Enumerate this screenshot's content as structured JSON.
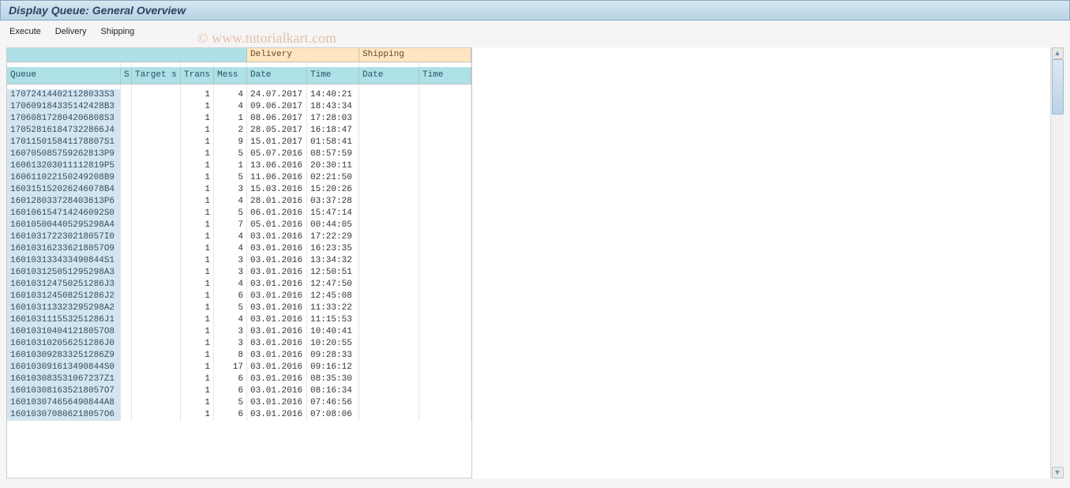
{
  "title": "Display Queue: General Overview",
  "menu": {
    "execute": "Execute",
    "delivery": "Delivery",
    "shipping": "Shipping"
  },
  "watermark": "© www.tutorialkart.com",
  "headers": {
    "group_delivery": "Delivery",
    "group_shipping": "Shipping",
    "queue": "Queue",
    "s": "S",
    "target": "Target s",
    "trans": "Trans",
    "mess": "Mess",
    "d_date": "Date",
    "d_time": "Time",
    "s_date": "Date",
    "s_time": "Time"
  },
  "rows": [
    {
      "queue": "170724144021128033S3",
      "s": "",
      "target": "",
      "trans": "1",
      "mess": "4",
      "d_date": "24.07.2017",
      "d_time": "14:40:21",
      "s_date": "",
      "s_time": ""
    },
    {
      "queue": "170609184335142428B3",
      "s": "",
      "target": "",
      "trans": "1",
      "mess": "4",
      "d_date": "09.06.2017",
      "d_time": "18:43:34",
      "s_date": "",
      "s_time": ""
    },
    {
      "queue": "170608172804206808S3",
      "s": "",
      "target": "",
      "trans": "1",
      "mess": "1",
      "d_date": "08.06.2017",
      "d_time": "17:28:03",
      "s_date": "",
      "s_time": ""
    },
    {
      "queue": "170528161847322866J4",
      "s": "",
      "target": "",
      "trans": "1",
      "mess": "2",
      "d_date": "28.05.2017",
      "d_time": "16:18:47",
      "s_date": "",
      "s_time": ""
    },
    {
      "queue": "170115015841178807S1",
      "s": "",
      "target": "",
      "trans": "1",
      "mess": "9",
      "d_date": "15.01.2017",
      "d_time": "01:58:41",
      "s_date": "",
      "s_time": ""
    },
    {
      "queue": "160705085759262813P9",
      "s": "",
      "target": "",
      "trans": "1",
      "mess": "5",
      "d_date": "05.07.2016",
      "d_time": "08:57:59",
      "s_date": "",
      "s_time": ""
    },
    {
      "queue": "160613203011112819P5",
      "s": "",
      "target": "",
      "trans": "1",
      "mess": "1",
      "d_date": "13.06.2016",
      "d_time": "20:30:11",
      "s_date": "",
      "s_time": ""
    },
    {
      "queue": "160611022150249208B9",
      "s": "",
      "target": "",
      "trans": "1",
      "mess": "5",
      "d_date": "11.06.2016",
      "d_time": "02:21:50",
      "s_date": "",
      "s_time": ""
    },
    {
      "queue": "160315152026246078B4",
      "s": "",
      "target": "",
      "trans": "1",
      "mess": "3",
      "d_date": "15.03.2016",
      "d_time": "15:20:26",
      "s_date": "",
      "s_time": ""
    },
    {
      "queue": "160128033728403613P6",
      "s": "",
      "target": "",
      "trans": "1",
      "mess": "4",
      "d_date": "28.01.2016",
      "d_time": "03:37:28",
      "s_date": "",
      "s_time": ""
    },
    {
      "queue": "160106154714246092S0",
      "s": "",
      "target": "",
      "trans": "1",
      "mess": "5",
      "d_date": "06.01.2016",
      "d_time": "15:47:14",
      "s_date": "",
      "s_time": ""
    },
    {
      "queue": "160105004405295298A4",
      "s": "",
      "target": "",
      "trans": "1",
      "mess": "7",
      "d_date": "05.01.2016",
      "d_time": "00:44:05",
      "s_date": "",
      "s_time": ""
    },
    {
      "queue": "160103172230218057I0",
      "s": "",
      "target": "",
      "trans": "1",
      "mess": "4",
      "d_date": "03.01.2016",
      "d_time": "17:22:29",
      "s_date": "",
      "s_time": ""
    },
    {
      "queue": "160103162336218057O9",
      "s": "",
      "target": "",
      "trans": "1",
      "mess": "4",
      "d_date": "03.01.2016",
      "d_time": "16:23:35",
      "s_date": "",
      "s_time": ""
    },
    {
      "queue": "160103133433490844S1",
      "s": "",
      "target": "",
      "trans": "1",
      "mess": "3",
      "d_date": "03.01.2016",
      "d_time": "13:34:32",
      "s_date": "",
      "s_time": ""
    },
    {
      "queue": "160103125051295298A3",
      "s": "",
      "target": "",
      "trans": "1",
      "mess": "3",
      "d_date": "03.01.2016",
      "d_time": "12:50:51",
      "s_date": "",
      "s_time": ""
    },
    {
      "queue": "160103124750251286J3",
      "s": "",
      "target": "",
      "trans": "1",
      "mess": "4",
      "d_date": "03.01.2016",
      "d_time": "12:47:50",
      "s_date": "",
      "s_time": ""
    },
    {
      "queue": "160103124508251286J2",
      "s": "",
      "target": "",
      "trans": "1",
      "mess": "6",
      "d_date": "03.01.2016",
      "d_time": "12:45:08",
      "s_date": "",
      "s_time": ""
    },
    {
      "queue": "160103113323295298A2",
      "s": "",
      "target": "",
      "trans": "1",
      "mess": "5",
      "d_date": "03.01.2016",
      "d_time": "11:33:22",
      "s_date": "",
      "s_time": ""
    },
    {
      "queue": "160103111553251286J1",
      "s": "",
      "target": "",
      "trans": "1",
      "mess": "4",
      "d_date": "03.01.2016",
      "d_time": "11:15:53",
      "s_date": "",
      "s_time": ""
    },
    {
      "queue": "160103104041218057O8",
      "s": "",
      "target": "",
      "trans": "1",
      "mess": "3",
      "d_date": "03.01.2016",
      "d_time": "10:40:41",
      "s_date": "",
      "s_time": ""
    },
    {
      "queue": "160103102056251286J0",
      "s": "",
      "target": "",
      "trans": "1",
      "mess": "3",
      "d_date": "03.01.2016",
      "d_time": "10:20:55",
      "s_date": "",
      "s_time": ""
    },
    {
      "queue": "160103092833251286Z9",
      "s": "",
      "target": "",
      "trans": "1",
      "mess": "8",
      "d_date": "03.01.2016",
      "d_time": "09:28:33",
      "s_date": "",
      "s_time": ""
    },
    {
      "queue": "160103091613490844S0",
      "s": "",
      "target": "",
      "trans": "1",
      "mess": "17",
      "d_date": "03.01.2016",
      "d_time": "09:16:12",
      "s_date": "",
      "s_time": ""
    },
    {
      "queue": "160103083531067237Z1",
      "s": "",
      "target": "",
      "trans": "1",
      "mess": "6",
      "d_date": "03.01.2016",
      "d_time": "08:35:30",
      "s_date": "",
      "s_time": ""
    },
    {
      "queue": "160103081635218057O7",
      "s": "",
      "target": "",
      "trans": "1",
      "mess": "6",
      "d_date": "03.01.2016",
      "d_time": "08:16:34",
      "s_date": "",
      "s_time": ""
    },
    {
      "queue": "160103074656490844A8",
      "s": "",
      "target": "",
      "trans": "1",
      "mess": "5",
      "d_date": "03.01.2016",
      "d_time": "07:46:56",
      "s_date": "",
      "s_time": ""
    },
    {
      "queue": "160103070806218057O6",
      "s": "",
      "target": "",
      "trans": "1",
      "mess": "6",
      "d_date": "03.01.2016",
      "d_time": "07:08:06",
      "s_date": "",
      "s_time": ""
    }
  ]
}
